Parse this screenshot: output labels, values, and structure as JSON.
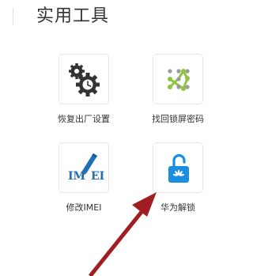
{
  "header": {
    "title": "实用工具"
  },
  "tools": [
    {
      "label": "恢复出厂设置",
      "icon": "gears-reset-icon"
    },
    {
      "label": "找回锁屏密码",
      "icon": "pattern-lock-icon"
    },
    {
      "label": "修改IMEI",
      "icon": "imei-edit-icon"
    },
    {
      "label": "华为解锁",
      "icon": "huawei-unlock-icon"
    }
  ],
  "imei_icon_text": {
    "left": "IM",
    "right": "EI"
  },
  "colors": {
    "gear": "#333333",
    "pattern_green": "#8dc63f",
    "pattern_dots": "#9a9a9a",
    "imei_blue": "#1f6fb2",
    "unlock_blue": "#1a8fe0",
    "arrow_red": "#a01e22"
  }
}
